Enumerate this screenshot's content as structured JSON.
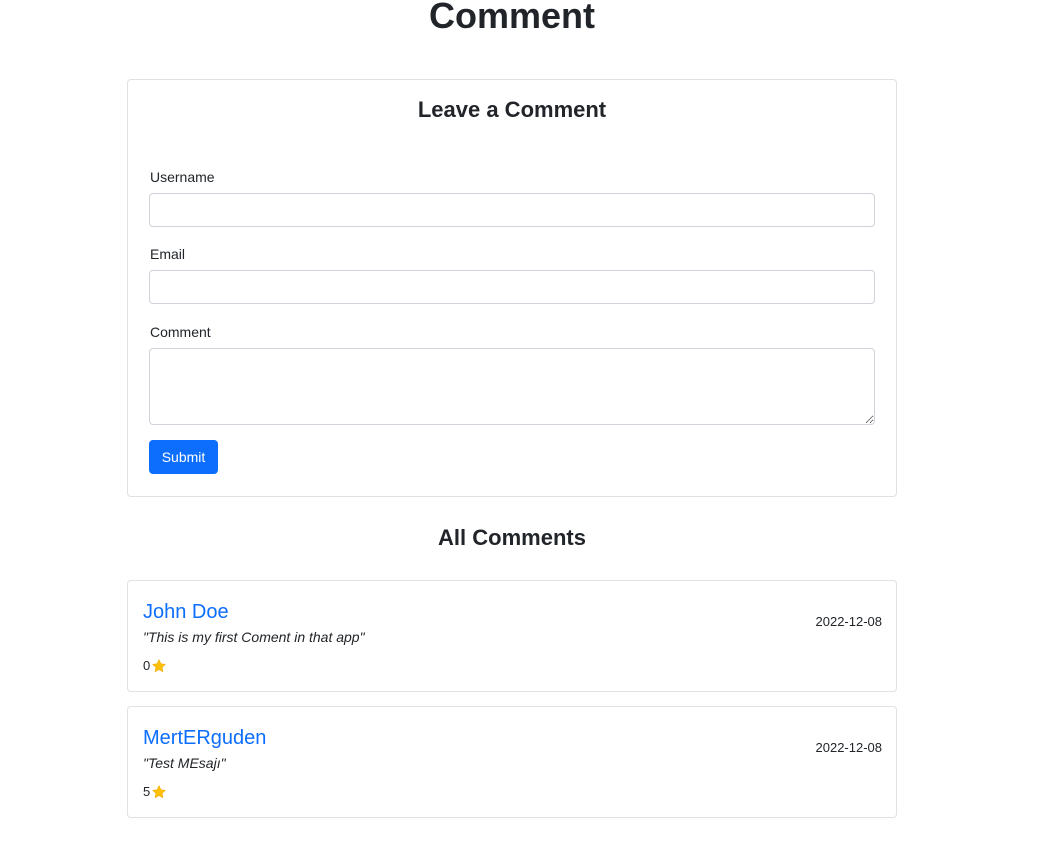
{
  "page": {
    "title": "Comment"
  },
  "form": {
    "title": "Leave a Comment",
    "username_label": "Username",
    "username_value": "",
    "email_label": "Email",
    "email_value": "",
    "comment_label": "Comment",
    "comment_value": "",
    "submit_label": "Submit"
  },
  "comments_section": {
    "title": "All Comments",
    "items": [
      {
        "username": "John Doe",
        "text": "\"This is my first Coment in that app\"",
        "date": "2022-12-08",
        "rating": "0",
        "icon": "star-icon"
      },
      {
        "username": "MertERguden",
        "text": "\"Test MEsajı\"",
        "date": "2022-12-08",
        "rating": "5",
        "icon": "star-icon"
      }
    ]
  },
  "colors": {
    "primary": "#0d6efd",
    "star": "#ffc107",
    "border": "#dee2e6",
    "text": "#212529"
  }
}
